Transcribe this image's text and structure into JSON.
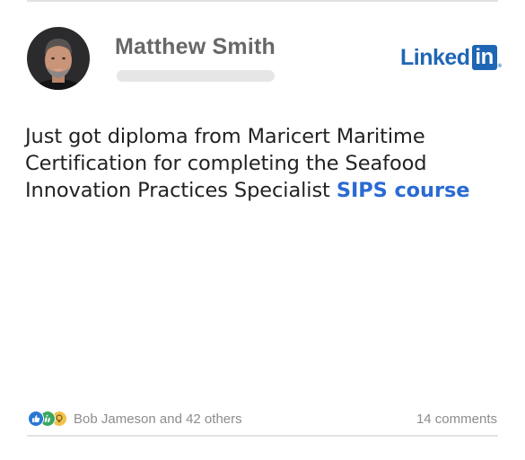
{
  "post": {
    "author_name": "Matthew Smith",
    "text_before_link": "Just got diploma from Maricert Maritime Certification for completing the Seafood Innovation Practices Specialist ",
    "link_text": "SIPS course"
  },
  "brand": {
    "name_word": "Linked",
    "name_box": "in",
    "registered_mark": "®",
    "color": "#1f66b5"
  },
  "footer": {
    "reaction_icons": [
      "like-icon",
      "celebrate-icon",
      "insightful-icon"
    ],
    "reactions_summary": "Bob Jameson and 42 others",
    "comments_count": "14 comments"
  },
  "colors": {
    "link": "#2a6ad3",
    "author_name": "#676767",
    "meta_text": "#8c8c8c"
  }
}
